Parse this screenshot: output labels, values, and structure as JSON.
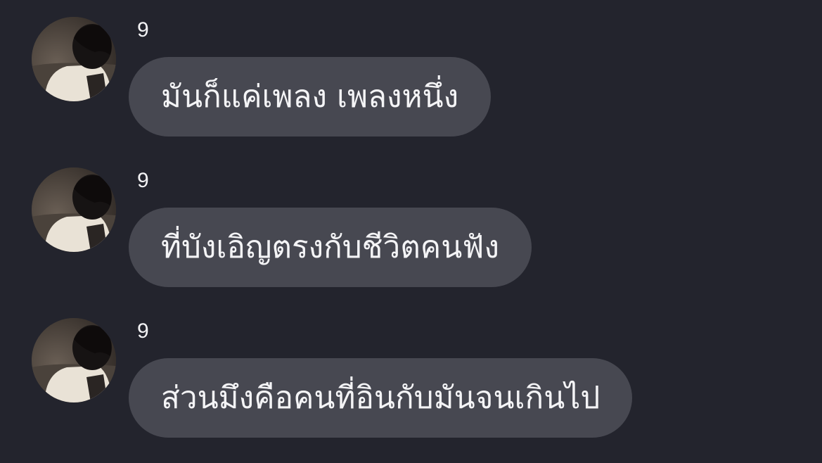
{
  "colors": {
    "background": "#23242d",
    "bubble": "#474851",
    "text": "#f4f4f6"
  },
  "messages": [
    {
      "sender": "9",
      "avatar_icon": "profile-photo",
      "text": "มันก็แค่เพลง เพลงหนึ่ง"
    },
    {
      "sender": "9",
      "avatar_icon": "profile-photo",
      "text": "ที่บังเอิญตรงกับชีวิตคนฟัง"
    },
    {
      "sender": "9",
      "avatar_icon": "profile-photo",
      "text": "ส่วนมึงคือคนที่อินกับมันจนเกินไป"
    }
  ]
}
